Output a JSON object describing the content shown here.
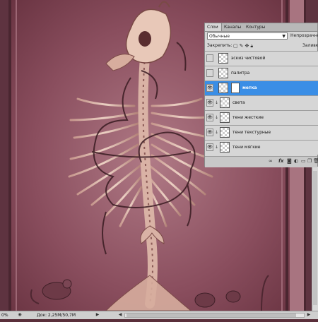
{
  "layers_panel": {
    "tabs": [
      "Слои",
      "Каналы",
      "Контуры"
    ],
    "blend_mode": "Обычные",
    "opacity_label": "Непрозрачность",
    "lock_label": "Закрепить:",
    "fill_label": "Заливк",
    "layers": [
      {
        "name": "эскиз чистовой",
        "visible": false,
        "selected": false,
        "clipped": false,
        "has_mask": false
      },
      {
        "name": "палитра",
        "visible": false,
        "selected": false,
        "clipped": false,
        "has_mask": false
      },
      {
        "name": "метка",
        "visible": true,
        "selected": true,
        "clipped": false,
        "has_mask": true
      },
      {
        "name": "света",
        "visible": true,
        "selected": false,
        "clipped": true,
        "has_mask": false
      },
      {
        "name": "тени жесткие",
        "visible": true,
        "selected": false,
        "clipped": true,
        "has_mask": false
      },
      {
        "name": "тени текстурные",
        "visible": true,
        "selected": false,
        "clipped": true,
        "has_mask": false
      },
      {
        "name": "тени мягкие",
        "visible": true,
        "selected": false,
        "clipped": true,
        "has_mask": false
      }
    ],
    "bottom_icons": [
      "link-icon",
      "fx-icon",
      "mask-icon",
      "adjustment-icon",
      "folder-icon",
      "new-layer-icon",
      "trash-icon"
    ]
  },
  "status_bar": {
    "zoom": "0%",
    "document": "Док: 2,25M/50,7M"
  },
  "colors": {
    "canvas_bg": "#8a4e5e",
    "selection": "#3a8ee6",
    "panel_bg": "#d6d6d6"
  }
}
